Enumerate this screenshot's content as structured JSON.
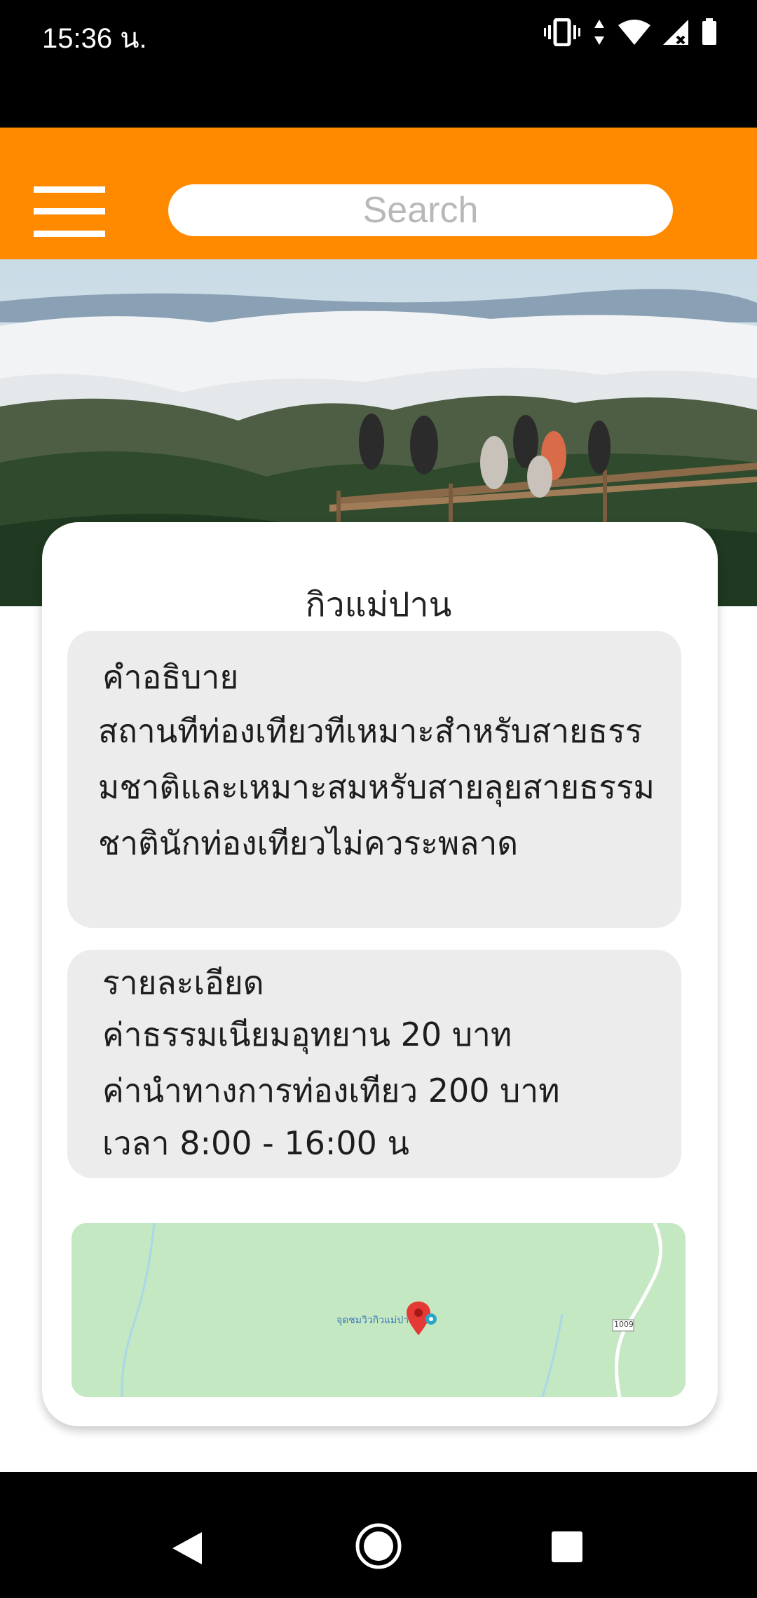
{
  "status_bar": {
    "time": "15:36 น."
  },
  "app_bar": {
    "search_placeholder": "Search"
  },
  "place": {
    "title": "กิวแม่ปาน",
    "description": {
      "heading": "คำอธิบาย",
      "lines": [
        "สถานทีท่องเทียวทีเหมาะสำหรับสายธรร",
        "มชาติและเหมาะสมหรับสายลุยสายธรรม",
        "ชาตินักท่องเทียวไม่ควระพลาด"
      ]
    },
    "details": {
      "heading": "รายละเอียด",
      "lines": [
        "ค่าธรรมเนียมอุทยาน 20 บาท",
        "ค่านำทางการท่องเทียว 200 บาท",
        "เวลา 8:00 - 16:00 น"
      ]
    }
  },
  "map": {
    "marker_label": "จุดชมวิวกิวแม่ปาน",
    "road_label": "1009",
    "marker_color": "#e53935"
  },
  "colors": {
    "app_bar": "#ff8a00",
    "panel": "#ececec",
    "map_land": "#c4e8c2"
  },
  "icons": [
    "vibrate-icon",
    "data-arrows-icon",
    "wifi-icon",
    "signal-icon",
    "battery-icon",
    "menu-icon",
    "back-icon",
    "home-icon",
    "recents-icon"
  ]
}
